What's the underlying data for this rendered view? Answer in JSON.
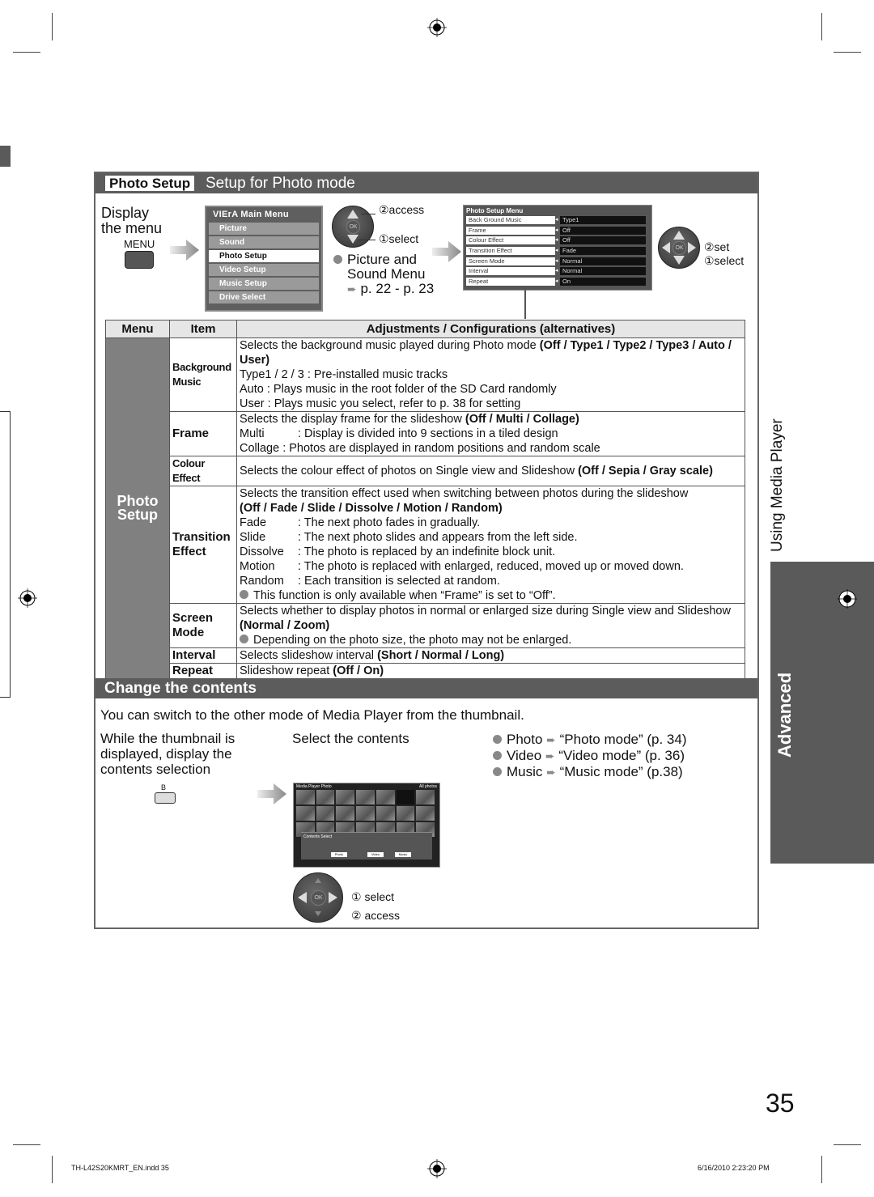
{
  "section": {
    "badge": "Photo Setup",
    "title": "Setup for Photo mode"
  },
  "step_display": {
    "label_line1": "Display",
    "label_line2": "the menu",
    "button_label": "MENU"
  },
  "main_menu": {
    "brand": "VIErA",
    "title": "Main Menu",
    "items": [
      {
        "label": "Picture",
        "selected": false
      },
      {
        "label": "Sound",
        "selected": false
      },
      {
        "label": "Photo Setup",
        "selected": true
      },
      {
        "label": "Video Setup",
        "selected": false
      },
      {
        "label": "Music Setup",
        "selected": false
      },
      {
        "label": "Drive Select",
        "selected": false
      }
    ]
  },
  "nav1": {
    "access": "②access",
    "select": "①select",
    "ok": "OK"
  },
  "note_picture_sound": {
    "line1": "Picture and",
    "line2": "Sound Menu",
    "ref": "p. 22 - p. 23"
  },
  "photo_setup_menu": {
    "title": "Photo Setup Menu",
    "rows": [
      {
        "label": "Back Ground Music",
        "value": "Type1"
      },
      {
        "label": "Frame",
        "value": "Off"
      },
      {
        "label": "Colour Effect",
        "value": "Off"
      },
      {
        "label": "Transition Effect",
        "value": "Fade"
      },
      {
        "label": "Screen Mode",
        "value": "Normal"
      },
      {
        "label": "Interval",
        "value": "Normal"
      },
      {
        "label": "Repeat",
        "value": "On"
      }
    ]
  },
  "nav2": {
    "set": "②set",
    "select": "①select",
    "ok": "OK"
  },
  "table": {
    "headers": [
      "Menu",
      "Item",
      "Adjustments / Configurations (alternatives)"
    ],
    "menu_label_line1": "Photo",
    "menu_label_line2": "Setup",
    "rows": {
      "bgm": {
        "item_line1": "Background",
        "item_line2": "Music",
        "desc": "Selects the background music played during Photo mode ",
        "options": "(Off / Type1 / Type2 / Type3 / Auto / User)",
        "lines": [
          "Type1 / 2 / 3 : Pre-installed music tracks",
          "Auto : Plays music in the root folder of the SD Card randomly",
          "User : Plays music you select, refer to p. 38 for setting"
        ]
      },
      "frame": {
        "item": "Frame",
        "desc": "Selects the display frame for the slideshow ",
        "options": "(Off / Multi / Collage)",
        "lines": [
          {
            "key": "Multi",
            "text": ": Display is divided into 9 sections in a tiled design"
          },
          {
            "key": "Collage",
            "text": ": Photos are displayed in random positions and random scale"
          }
        ]
      },
      "colour": {
        "item": "Colour Effect",
        "desc": "Selects the colour effect of photos on Single view and Slideshow ",
        "options": "(Off / Sepia / Gray scale)"
      },
      "transition": {
        "item_line1": "Transition",
        "item_line2": "Effect",
        "desc": "Selects the transition effect used when switching between photos during the slideshow",
        "options": "(Off / Fade / Slide / Dissolve / Motion / Random)",
        "lines": [
          {
            "key": "Fade",
            "text": ": The next photo fades in gradually."
          },
          {
            "key": "Slide",
            "text": ": The next photo slides and appears from the left side."
          },
          {
            "key": "Dissolve",
            "text": ": The photo is replaced by an indefinite block unit."
          },
          {
            "key": "Motion",
            "text": ": The photo is replaced with enlarged, reduced, moved up or moved down."
          },
          {
            "key": "Random",
            "text": ": Each transition is selected at random."
          }
        ],
        "note": "This function is only available when “Frame” is set to “Off”."
      },
      "screen": {
        "item_line1": "Screen",
        "item_line2": "Mode",
        "desc": "Selects whether to display photos in normal or enlarged size during Single view and Slideshow ",
        "options": "(Normal / Zoom)",
        "note": "Depending on the photo size, the photo may not be enlarged."
      },
      "interval": {
        "item": "Interval",
        "desc": "Selects slideshow interval ",
        "options": "(Short / Normal / Long)"
      },
      "repeat": {
        "item": "Repeat",
        "desc": "Slideshow repeat ",
        "options": "(Off / On)"
      }
    }
  },
  "change": {
    "title": "Change the contents",
    "intro": "You can switch to the other mode of Media Player from the thumbnail.",
    "step1_line1": "While the thumbnail is",
    "step1_line2": "displayed, display the",
    "step1_line3": "contents selection",
    "b_button": "B",
    "step2": "Select the contents",
    "modes": [
      {
        "name": "Photo",
        "ref": "“Photo mode” (p. 34)"
      },
      {
        "name": "Video",
        "ref": "“Video mode” (p. 36)"
      },
      {
        "name": "Music",
        "ref": "“Music mode” (p.38)"
      }
    ],
    "thumb": {
      "bar_left": "Media Player  Photo",
      "bar_right": "All photos",
      "overlay_title": "Contents Select",
      "btn_photo": "Photo",
      "btn_video": "Video",
      "btn_music": "Music"
    },
    "nav_select": "① select",
    "nav_access": "② access",
    "ok": "OK"
  },
  "side": {
    "chapter": "Using Media Player",
    "tab": "Advanced"
  },
  "page_number": "35",
  "footer": {
    "file": "TH-L42S20KMRT_EN.indd   35",
    "timestamp": "6/16/2010   2:23:20 PM"
  },
  "colors": {
    "header_bg": "#5c5c5c",
    "menu_cell_bg": "#808080",
    "tab_bg": "#5a5a5a"
  }
}
